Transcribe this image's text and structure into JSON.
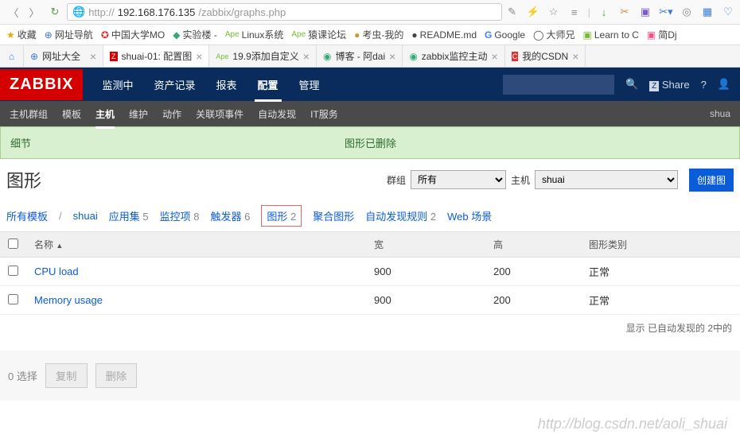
{
  "url_prefix": "http://",
  "url_host": "192.168.176.135",
  "url_path": "/zabbix/graphs.php",
  "bookmarks": [
    "收藏",
    "网址导航",
    "中国大学MO",
    "实验楼 - ",
    "Linux系统",
    "猿课论坛",
    "考虫-我的",
    "README.md",
    "Google",
    "大师兄",
    "Learn to C",
    "简Dj"
  ],
  "tabs": [
    {
      "label": "网址大全"
    },
    {
      "label": "shuai-01: 配置图"
    },
    {
      "label": "19.9添加自定义"
    },
    {
      "label": "博客 - 阿dai"
    },
    {
      "label": "zabbix监控主动"
    },
    {
      "label": "我的CSDN"
    }
  ],
  "zlogo": "ZABBIX",
  "topnav": [
    "监测中",
    "资产记录",
    "报表",
    "配置",
    "管理"
  ],
  "topnav_active": 3,
  "share_label": "Share",
  "subnav": [
    "主机群组",
    "模板",
    "主机",
    "维护",
    "动作",
    "关联项事件",
    "自动发现",
    "IT服务"
  ],
  "subnav_active": 2,
  "subnav_right": "shua",
  "notice_left": "细节",
  "notice_right": "图形已删除",
  "page_title": "图形",
  "filter_group_label": "群组",
  "filter_group_value": "所有",
  "filter_host_label": "主机",
  "filter_host_value": "shuai",
  "btn_create": "创建图",
  "breadcrumb": {
    "all_templates": "所有模板",
    "host": "shuai",
    "items": [
      {
        "label": "应用集",
        "count": "5"
      },
      {
        "label": "监控项",
        "count": "8"
      },
      {
        "label": "触发器",
        "count": "6"
      },
      {
        "label": "图形",
        "count": "2",
        "selected": true
      },
      {
        "label": "聚合图形",
        "count": ""
      },
      {
        "label": "自动发现规则",
        "count": "2"
      },
      {
        "label": "Web 场景",
        "count": ""
      }
    ]
  },
  "columns": {
    "name": "名称",
    "width": "宽",
    "height": "高",
    "type": "图形类别"
  },
  "sort_indicator": "▲",
  "rows": [
    {
      "name": "CPU load",
      "width": "900",
      "height": "200",
      "type": "正常"
    },
    {
      "name": "Memory usage",
      "width": "900",
      "height": "200",
      "type": "正常"
    }
  ],
  "footer_text": "显示 已自动发现的 2中的",
  "action_selected": "0 选择",
  "btn_copy": "复制",
  "btn_delete": "删除",
  "watermark": "http://blog.csdn.net/aoli_shuai"
}
